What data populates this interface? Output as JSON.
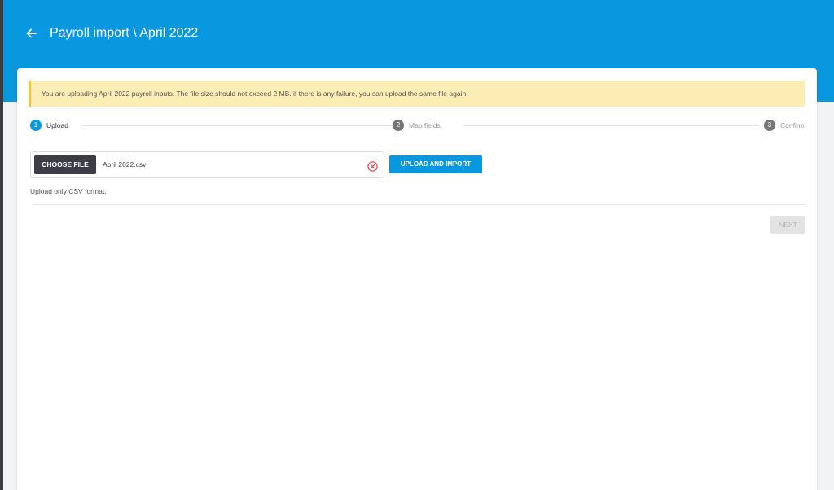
{
  "header": {
    "title": "Payroll import \\ April 2022",
    "back_icon": "arrow-left-icon",
    "background_color": "#0898df"
  },
  "alert": {
    "message": "You are uploading April 2022 payroll inputs. The file size should not exceed 2 MB. if there is any failure, you can upload the same file again.",
    "background_color": "#fcedb4",
    "border_color": "#f1c532"
  },
  "stepper": {
    "steps": [
      {
        "number": "1",
        "label": "Upload",
        "active": true
      },
      {
        "number": "2",
        "label": "Map fields",
        "active": false
      },
      {
        "number": "3",
        "label": "Confirm",
        "active": false
      }
    ]
  },
  "upload": {
    "choose_file_label": "CHOOSE FILE",
    "file_name": "April 2022.csv",
    "clear_icon": "close-circle-icon",
    "upload_button_label": "UPLOAD AND IMPORT",
    "hint": "Upload only CSV format."
  },
  "footer": {
    "next_label": "NEXT",
    "next_disabled": true
  }
}
